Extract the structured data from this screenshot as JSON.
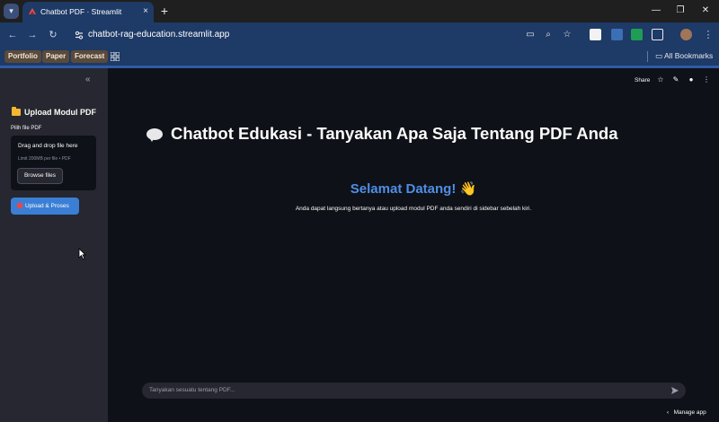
{
  "browser": {
    "tab_title": "Chatbot PDF · Streamlit",
    "tab_close_icon": "close-icon",
    "new_tab_icon": "plus-icon",
    "url": "chatbot-rag-education.streamlit.app",
    "window_controls": [
      "minimize-icon",
      "restore-icon",
      "close-icon"
    ],
    "bookmarks": [
      "Portfolio",
      "Paper",
      "Forecast"
    ],
    "all_bookmarks_label": "All Bookmarks"
  },
  "sidebar": {
    "header": "Upload Modul PDF",
    "file_label": "Pilih file PDF",
    "dropzone_title": "Drag and drop file here",
    "dropzone_limit": "Limit 200MB per file • PDF",
    "browse_label": "Browse files",
    "upload_label": "Upload & Proses"
  },
  "main": {
    "share_label": "Share",
    "title": "Chatbot Edukasi - Tanyakan Apa Saja Tentang PDF Anda",
    "welcome": "Selamat Datang!",
    "welcome_emoji": "👋",
    "subtitle": "Anda dapat langsung bertanya atau upload modul PDF anda sendiri di sidebar sebelah kiri.",
    "chat_placeholder": "Tanyakan sesuatu tentang PDF...",
    "manage_app_label": "Manage app"
  },
  "colors": {
    "app_background": "#0e1117",
    "sidebar_background": "#262730",
    "accent_blue": "#4f8ee6",
    "button_blue": "#3a7fd5",
    "chrome_blue": "#1e3a66"
  }
}
